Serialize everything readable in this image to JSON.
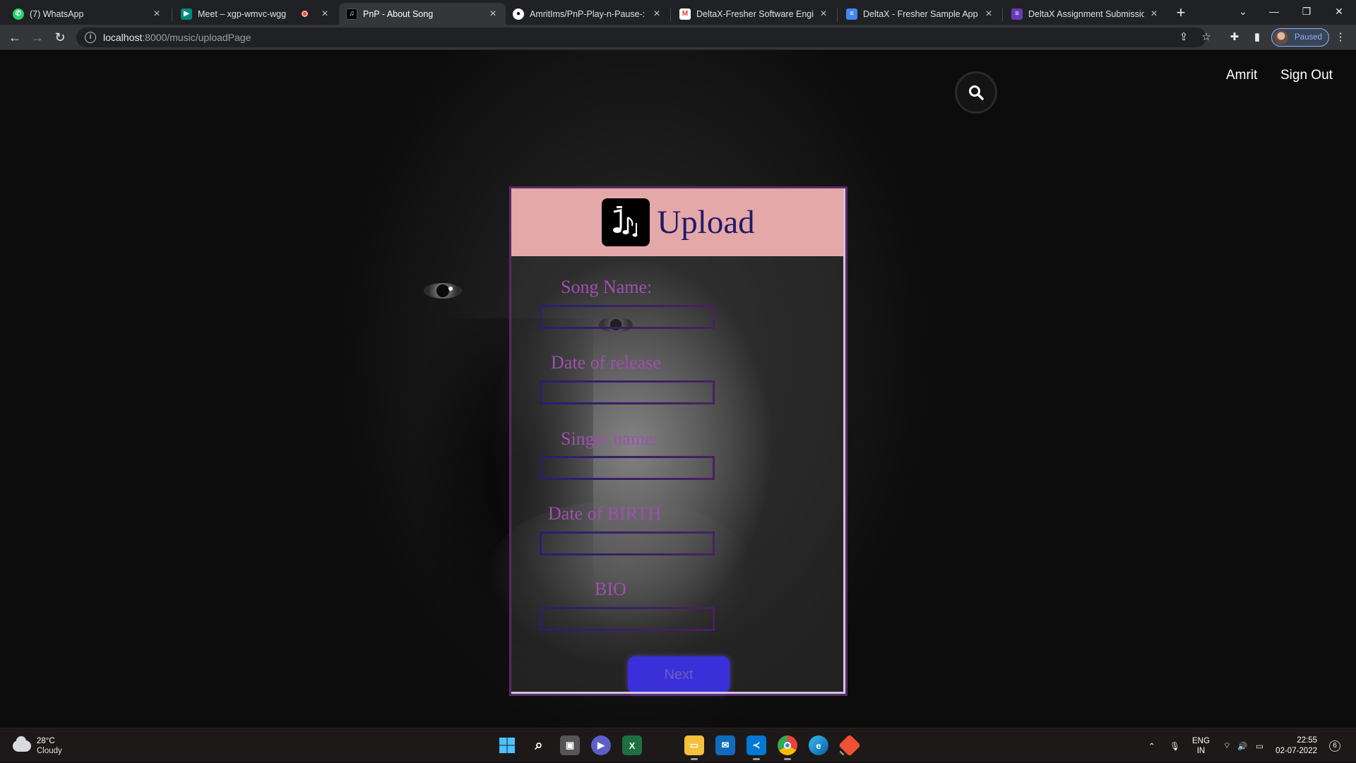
{
  "browser": {
    "tabs": [
      {
        "title": "(7) WhatsApp",
        "icon": "whatsapp-icon",
        "color": "#25d366"
      },
      {
        "title": "Meet – xgp-wmvc-wgg",
        "icon": "google-meet-icon",
        "color": "#00897b",
        "recording": true
      },
      {
        "title": "PnP - About Song",
        "icon": "pnp-music-icon",
        "color": "#000000",
        "active": true
      },
      {
        "title": "AmritIms/PnP-Play-n-Pause-: It c",
        "icon": "github-icon",
        "color": "#ffffff"
      },
      {
        "title": "DeltaX-Fresher Software Engine",
        "icon": "gmail-icon",
        "color": "#ea4335"
      },
      {
        "title": "DeltaX - Fresher Sample App - S",
        "icon": "google-docs-icon",
        "color": "#4285f4"
      },
      {
        "title": "DeltaX Assignment Submission",
        "icon": "google-forms-icon",
        "color": "#673ab7"
      }
    ],
    "url_host": "localhost",
    "url_path": ":8000/music/uploadPage",
    "profile_status": "Paused"
  },
  "page": {
    "nav": {
      "user_name": "Amrit",
      "sign_out": "Sign Out"
    },
    "card": {
      "title": "Upload",
      "fields": [
        {
          "label": "Song Name:",
          "value": ""
        },
        {
          "label": "Date of release",
          "value": ""
        },
        {
          "label": "Singer name:",
          "value": ""
        },
        {
          "label": "Date of BIRTH",
          "value": ""
        },
        {
          "label": "BIO",
          "value": ""
        }
      ],
      "submit_label": "Next"
    },
    "colors": {
      "header_bg": "#e5a8a8",
      "title": "#1e1a6a",
      "label": "#a04fb0",
      "button": "#3a2fd8"
    }
  },
  "taskbar": {
    "weather_temp": "28°C",
    "weather_cond": "Cloudy",
    "lang": "ENG",
    "region": "IN",
    "time": "22:55",
    "date": "02-07-2022",
    "notifications": "6"
  }
}
